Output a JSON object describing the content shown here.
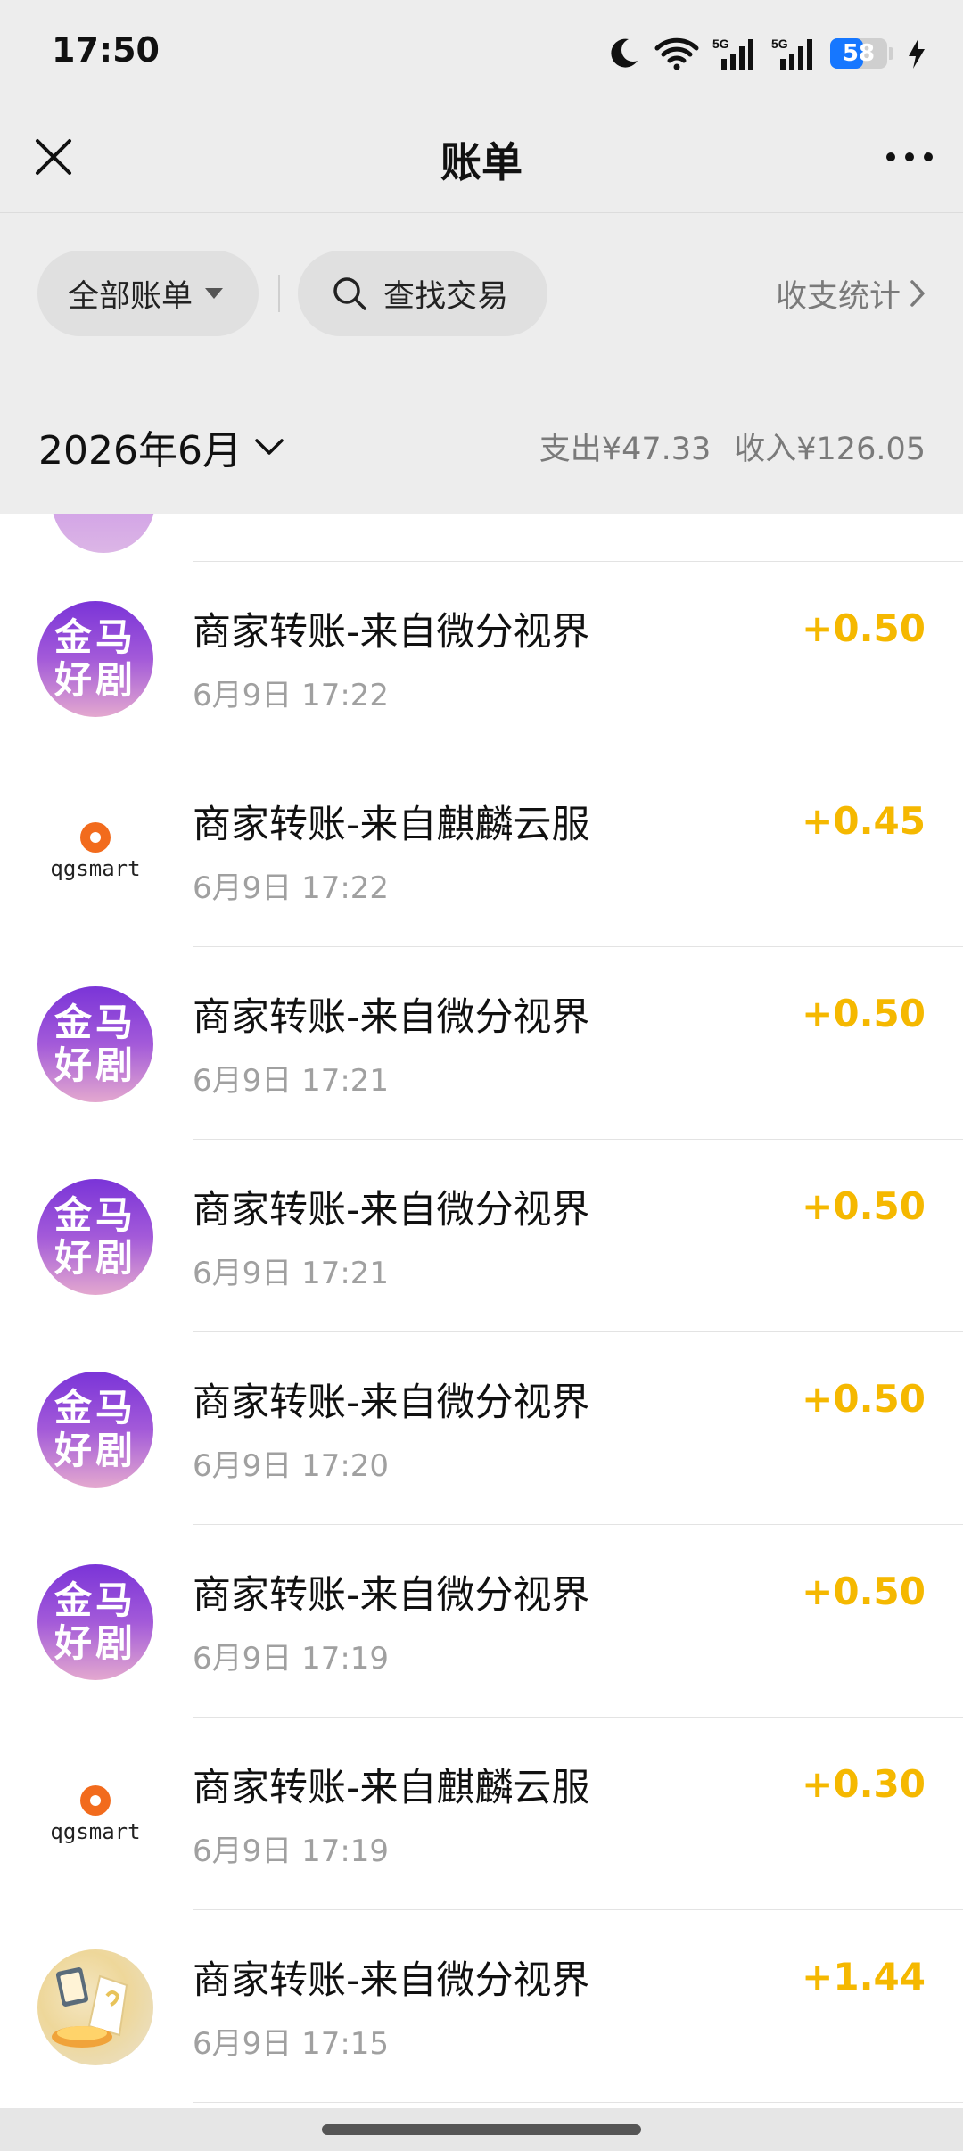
{
  "status_bar": {
    "time": "17:50",
    "battery": "58",
    "battery_level": 0.58,
    "icons": [
      "moon-icon",
      "wifi-icon",
      "signal-5g-icon",
      "signal-5g-icon",
      "battery-icon",
      "charging-icon"
    ]
  },
  "header": {
    "title": "账单",
    "close_icon": "close-icon",
    "more_icon": "more-icon"
  },
  "filters": {
    "all_bills": "全部账单",
    "search": "查找交易",
    "stats": "收支统计"
  },
  "month_bar": {
    "month": "2026年6月",
    "expense": "支出¥47.33",
    "income": "收入¥126.05"
  },
  "transactions": [
    {
      "title": "商家转账-来自微分视界",
      "time": "6月9日 17:22",
      "amount": "+0.50",
      "avatar": "jinma"
    },
    {
      "title": "商家转账-来自麒麟云服",
      "time": "6月9日 17:22",
      "amount": "+0.45",
      "avatar": "qgsmart"
    },
    {
      "title": "商家转账-来自微分视界",
      "time": "6月9日 17:21",
      "amount": "+0.50",
      "avatar": "jinma"
    },
    {
      "title": "商家转账-来自微分视界",
      "time": "6月9日 17:21",
      "amount": "+0.50",
      "avatar": "jinma"
    },
    {
      "title": "商家转账-来自微分视界",
      "time": "6月9日 17:20",
      "amount": "+0.50",
      "avatar": "jinma"
    },
    {
      "title": "商家转账-来自微分视界",
      "time": "6月9日 17:19",
      "amount": "+0.50",
      "avatar": "jinma"
    },
    {
      "title": "商家转账-来自麒麟云服",
      "time": "6月9日 17:19",
      "amount": "+0.30",
      "avatar": "qgsmart"
    },
    {
      "title": "商家转账-来自微分视界",
      "time": "6月9日 17:15",
      "amount": "+1.44",
      "avatar": "illustration"
    }
  ],
  "avatar_text": {
    "jinma_line1": "金马",
    "jinma_line2": "好剧",
    "qgsmart": "qgsmart"
  },
  "colors": {
    "income_amount": "#f5b800",
    "header_bg": "#ededed",
    "jinma_avatar_top": "#7a34d8",
    "qgsmart_accent": "#f26b1d"
  }
}
